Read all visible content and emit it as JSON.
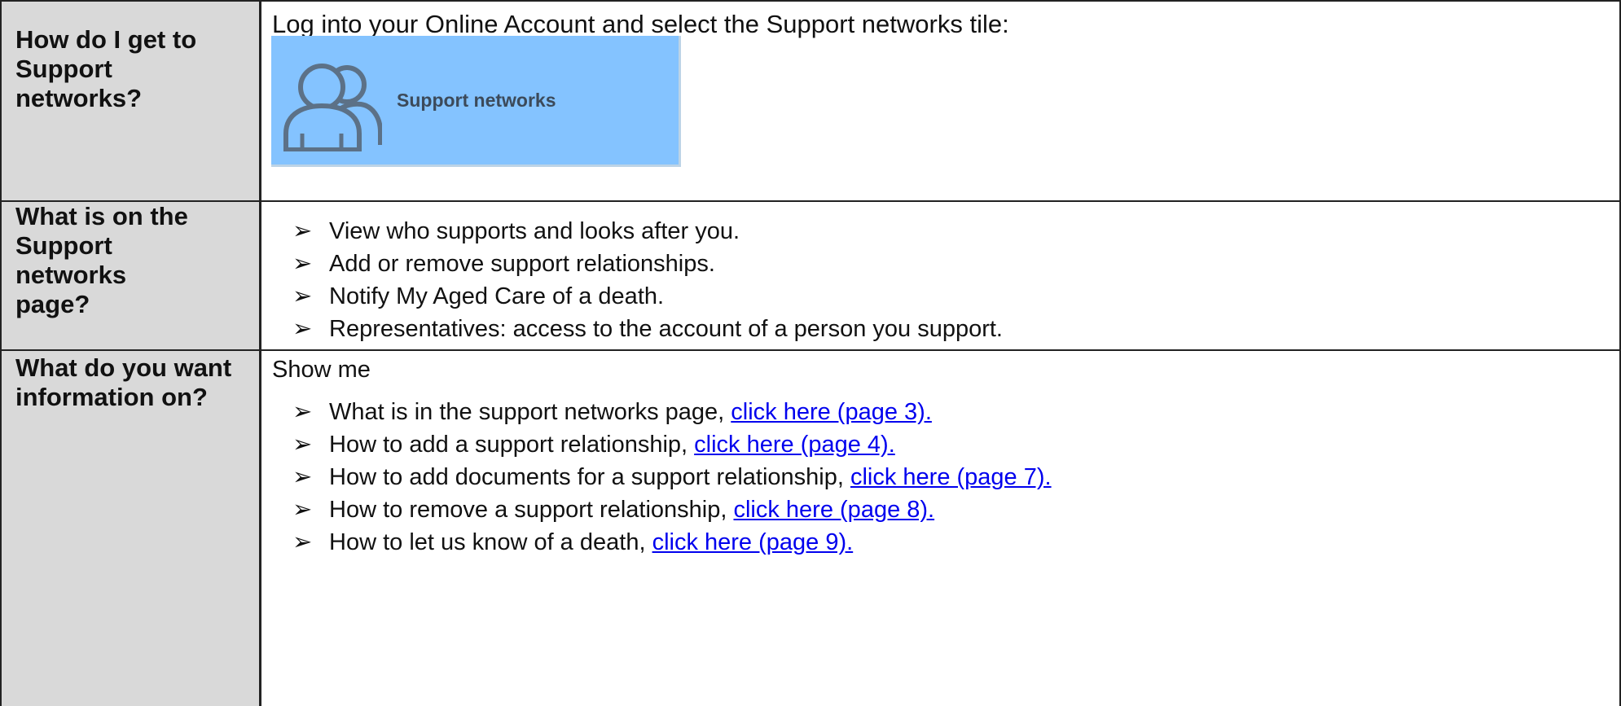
{
  "rows": [
    {
      "heading_lines": [
        "How do I get to",
        "Support",
        "networks?"
      ],
      "intro": "Log into your Online Account and select the Support networks tile:",
      "tile": {
        "label": "Support networks",
        "icon": "people-icon",
        "color": "#84c3ff"
      }
    },
    {
      "heading_lines": [
        "What is on the",
        "Support",
        "networks",
        "page?"
      ],
      "items": [
        "View who supports and looks after you.",
        "Add or remove support relationships.",
        "Notify My Aged Care of a death.",
        "Representatives: access to the account of a person you support."
      ]
    },
    {
      "heading_lines": [
        "What do you want",
        "information on?"
      ],
      "lead": "Show me",
      "items": [
        {
          "text": "What is in the support networks page, ",
          "link": "click here (page 3)."
        },
        {
          "text": "How to add a support relationship, ",
          "link": "click here (page 4)."
        },
        {
          "text": "How to add documents for a support relationship, ",
          "link": "click here (page 7)."
        },
        {
          "text": "How to remove a support relationship, ",
          "link": "click here (page 8)."
        },
        {
          "text": "How to let us know of a death, ",
          "link": "click here (page 9)."
        }
      ]
    }
  ],
  "bullet_glyph": "➢",
  "colors": {
    "header_bg": "#d9d9d9",
    "link": "#0000ee",
    "tile_bg": "#84c3ff",
    "border": "#222222"
  }
}
